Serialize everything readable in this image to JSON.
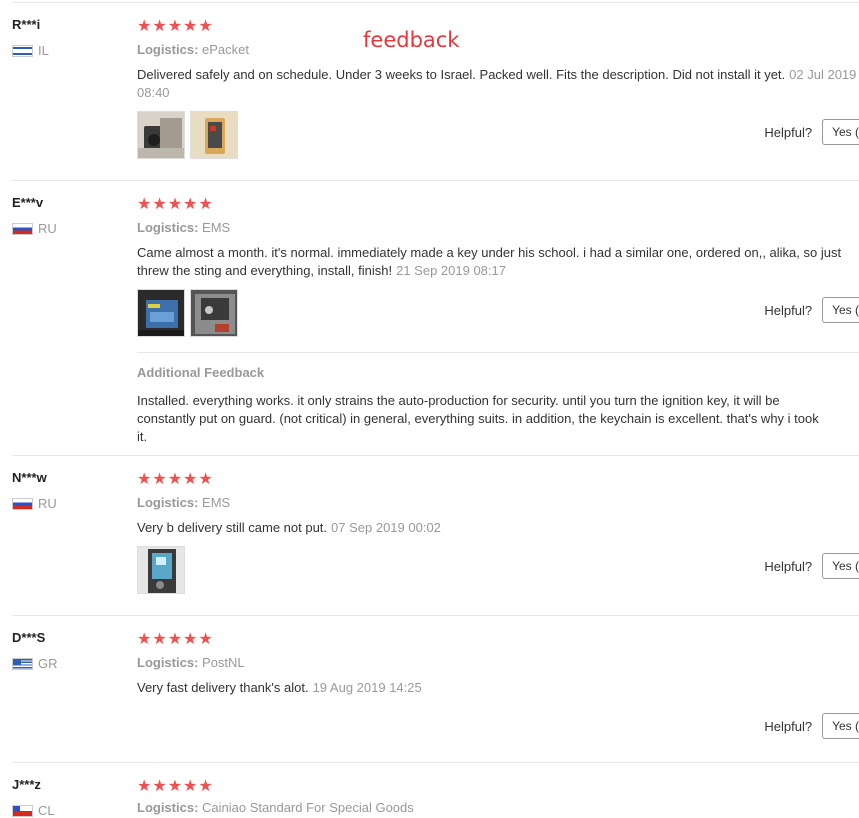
{
  "overlay": {
    "label": "feedback"
  },
  "ui": {
    "helpful_label": "Helpful?",
    "yes_label": "Yes (",
    "logistics_label": "Logistics:"
  },
  "reviews": [
    {
      "user": "R***i",
      "country_code": "IL",
      "country_flag": "israel-flag-icon",
      "rating": 5,
      "stars": "★★★★★",
      "logistics": "ePacket",
      "text": "Delivered safely and on schedule. Under 3 weeks to Israel. Packed well. Fits the description. Did not install it yet.",
      "date": "02 Jul 2019 08:40",
      "photos": [
        "review-photo",
        "review-photo"
      ]
    },
    {
      "user": "E***v",
      "country_code": "RU",
      "country_flag": "russia-flag-icon",
      "rating": 5,
      "stars": "★★★★★",
      "logistics": "EMS",
      "text": "Came almost a month. it's normal. immediately made a key under his school. i had a similar one, ordered on,, alika, so just threw the sting and everything, install, finish!",
      "date": "21 Sep 2019 08:17",
      "photos": [
        "review-photo",
        "review-photo"
      ],
      "additional": {
        "title": "Additional Feedback",
        "text": "Installed. everything works. it only strains the auto-production for security. until you turn the ignition key, it will be constantly put on guard. (not critical) in general, everything suits. in addition, the keychain is excellent. that's why i took it."
      }
    },
    {
      "user": "N***w",
      "country_code": "RU",
      "country_flag": "russia-flag-icon",
      "rating": 5,
      "stars": "★★★★★",
      "logistics": "EMS",
      "text": "Very b delivery still came not put.",
      "date": "07 Sep 2019 00:02",
      "photos": [
        "review-photo"
      ]
    },
    {
      "user": "D***S",
      "country_code": "GR",
      "country_flag": "greece-flag-icon",
      "rating": 5,
      "stars": "★★★★★",
      "logistics": "PostNL",
      "text": "Very fast delivery thank's alot.",
      "date": "19 Aug 2019 14:25",
      "photos": []
    },
    {
      "user": "J***z",
      "country_code": "CL",
      "country_flag": "chile-flag-icon",
      "rating": 5,
      "stars": "★★★★★",
      "logistics": "Cainiao Standard For Special Goods"
    }
  ]
}
